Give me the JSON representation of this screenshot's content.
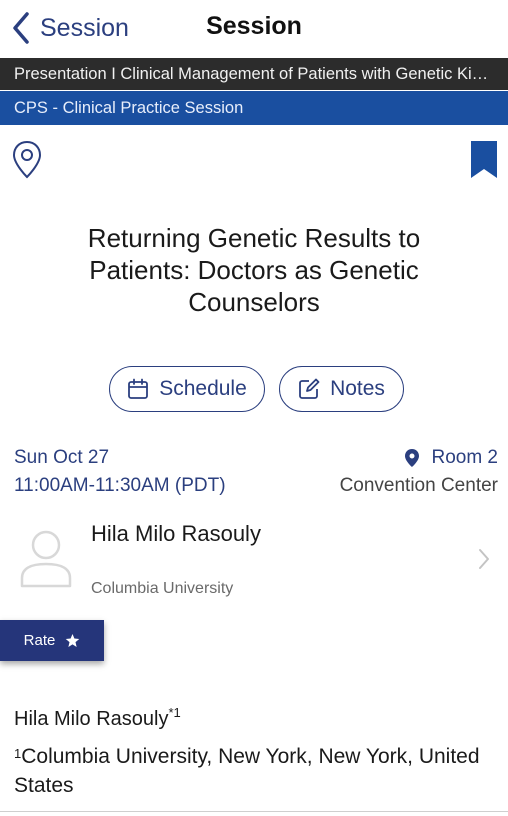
{
  "nav": {
    "back_label": "Session",
    "title": "Session"
  },
  "presentation_bar": "Presentation I Clinical Management of Patients with Genetic Kid…",
  "category_bar": "CPS - Clinical Practice Session",
  "icons": {
    "location": "map-pin-outline-icon",
    "bookmark": "bookmark-filled-icon"
  },
  "session": {
    "title": "Returning Genetic Results to Patients: Doctors as Genetic Counselors",
    "schedule_label": "Schedule",
    "notes_label": "Notes",
    "date": "Sun Oct 27",
    "time": "11:00AM-11:30AM (PDT)",
    "room": "Room 2",
    "venue": "Convention Center"
  },
  "speaker": {
    "name": "Hila Milo Rasouly",
    "affiliation": "Columbia University"
  },
  "rate_label": "Rate",
  "authors": {
    "name": "Hila Milo Rasouly",
    "marker": "*1",
    "aff_marker": "1",
    "affiliation": "Columbia University, New York, New York, United States"
  },
  "colors": {
    "accent": "#2b3f7f",
    "category_bar": "#1a4fa0",
    "presentation_bar": "#2c2c2c",
    "rate_button": "#25357a"
  }
}
